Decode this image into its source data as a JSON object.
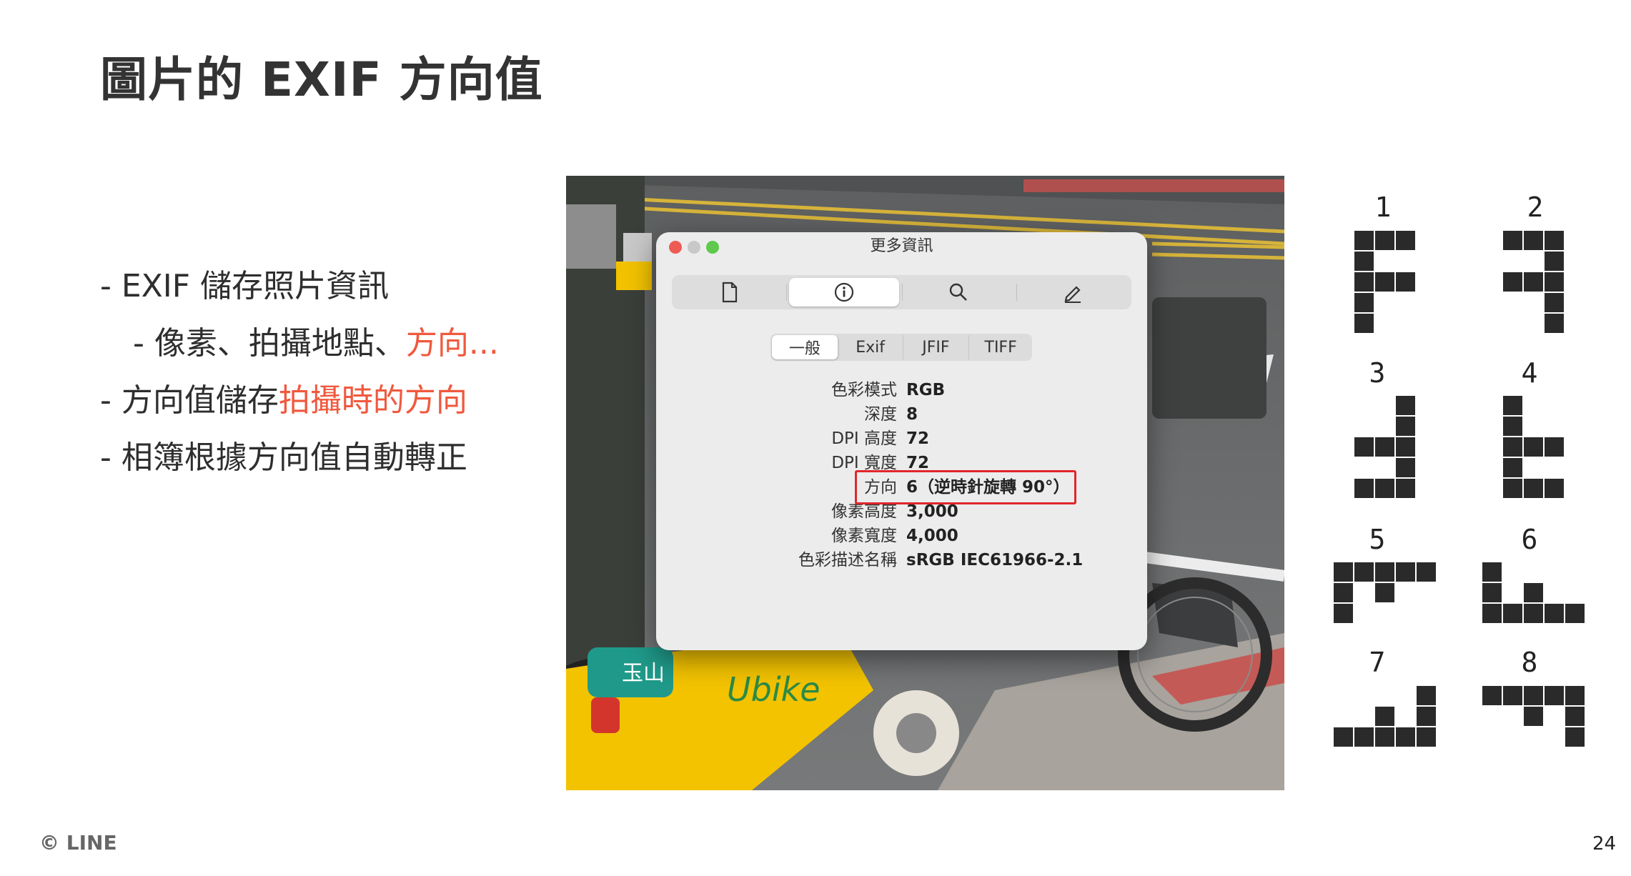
{
  "title": "圖片的 EXIF 方向值",
  "bullets": {
    "b1": "- EXIF 儲存照片資訊",
    "b2_prefix": "- 像素、拍攝地點、",
    "b2_highlight": "方向...",
    "b3_prefix": "- 方向值儲存",
    "b3_highlight": "拍攝時的方向",
    "b4": "- 相簿根據方向值自動轉正"
  },
  "dialog": {
    "title": "更多資訊",
    "toolbar": [
      "file-icon",
      "info-icon",
      "search-icon",
      "edit-icon"
    ],
    "tabs": [
      "一般",
      "Exif",
      "JFIF",
      "TIFF"
    ],
    "active_tab": "一般",
    "rows": [
      {
        "key": "色彩模式",
        "value": "RGB"
      },
      {
        "key": "深度",
        "value": "8"
      },
      {
        "key": "DPI 高度",
        "value": "72"
      },
      {
        "key": "DPI 寬度",
        "value": "72"
      },
      {
        "key": "方向",
        "value": "6（逆時針旋轉 90°）"
      },
      {
        "key": "像素高度",
        "value": "3,000"
      },
      {
        "key": "像素寬度",
        "value": "4,000"
      },
      {
        "key": "色彩描述名稱",
        "value": "sRGB IEC61966-2.1"
      }
    ]
  },
  "photo": {
    "bike_station_name": "玉山",
    "bike_brand": "Ubike"
  },
  "orientations": [
    {
      "label": "1",
      "rows": [
        "111",
        "100",
        "111",
        "100",
        "100"
      ]
    },
    {
      "label": "2",
      "rows": [
        "111",
        "001",
        "111",
        "001",
        "001"
      ]
    },
    {
      "label": "3",
      "rows": [
        "001",
        "001",
        "111",
        "001",
        "111"
      ]
    },
    {
      "label": "4",
      "rows": [
        "100",
        "100",
        "111",
        "100",
        "111"
      ]
    },
    {
      "label": "5",
      "rows": [
        "11111",
        "10100",
        "10000"
      ]
    },
    {
      "label": "6",
      "rows": [
        "10000",
        "10100",
        "11111"
      ]
    },
    {
      "label": "7",
      "rows": [
        "00001",
        "00101",
        "11111"
      ]
    },
    {
      "label": "8",
      "rows": [
        "11111",
        "00101",
        "00001"
      ]
    }
  ],
  "footer": {
    "logo": "© LINE",
    "page": "24"
  },
  "colors": {
    "accent": "#f0593e",
    "highlight_box": "#e0262b"
  }
}
